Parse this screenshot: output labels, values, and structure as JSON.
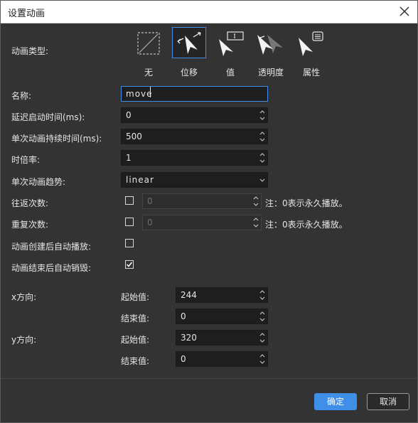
{
  "dialog": {
    "title": "设置动画",
    "close_icon": "close-icon"
  },
  "anim_type": {
    "label": "动画类型:",
    "options": [
      {
        "label": "无",
        "icon": "none-icon",
        "selected": false
      },
      {
        "label": "位移",
        "icon": "move-icon",
        "selected": true
      },
      {
        "label": "值",
        "icon": "value-icon",
        "selected": false
      },
      {
        "label": "透明度",
        "icon": "opacity-icon",
        "selected": false
      },
      {
        "label": "属性",
        "icon": "property-icon",
        "selected": false
      }
    ]
  },
  "form": {
    "name_label": "名称:",
    "name_value": "move",
    "delay_label": "延迟启动时间(ms):",
    "delay_value": "0",
    "duration_label": "单次动画持续时间(ms):",
    "duration_value": "500",
    "rate_label": "时倍率:",
    "rate_value": "1",
    "easing_label": "单次动画趋势:",
    "easing_value": "linear",
    "yoyo_label": "往返次数:",
    "yoyo_value": "0",
    "yoyo_note": "注：0表示永久播放。",
    "repeat_label": "重复次数:",
    "repeat_value": "0",
    "repeat_note": "注：0表示永久播放。",
    "autoplay_label": "动画创建后自动播放:",
    "autoplay_checked": false,
    "autodestroy_label": "动画结束后自动销毁:",
    "autodestroy_checked": true
  },
  "x_dir": {
    "label": "x方向:",
    "start_label": "起始值:",
    "start_value": "244",
    "end_label": "结束值:",
    "end_value": "0"
  },
  "y_dir": {
    "label": "y方向:",
    "start_label": "起始值:",
    "start_value": "320",
    "end_label": "结束值:",
    "end_value": "0"
  },
  "footer": {
    "ok_label": "确定",
    "cancel_label": "取消"
  },
  "colors": {
    "accent": "#3f8ee8",
    "background": "#333333",
    "field": "#1e1e1e"
  }
}
